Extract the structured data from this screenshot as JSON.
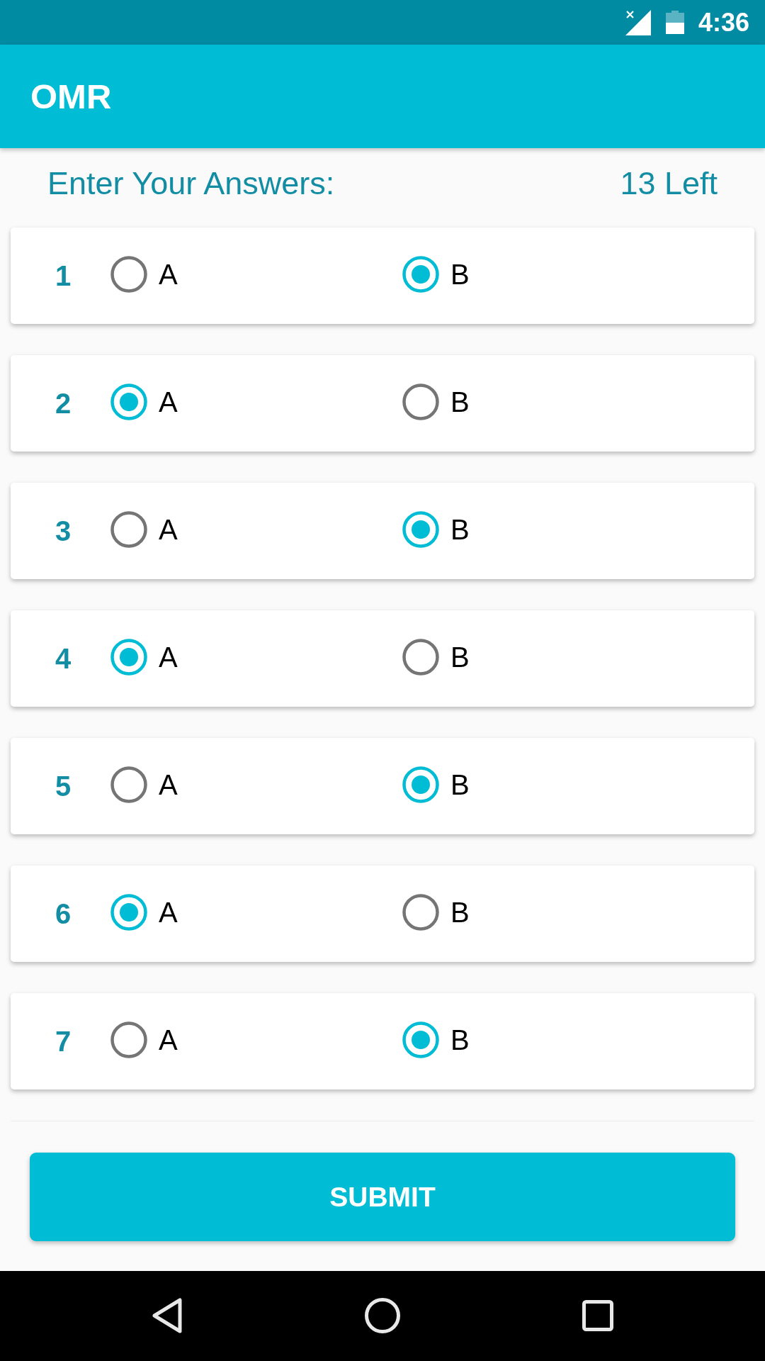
{
  "status_bar": {
    "time": "4:36"
  },
  "app_bar": {
    "title": "OMR"
  },
  "header": {
    "prompt": "Enter Your Answers:",
    "remaining": "13 Left"
  },
  "questions": [
    {
      "number": "1",
      "options": [
        {
          "label": "A",
          "selected": false
        },
        {
          "label": "B",
          "selected": true
        }
      ]
    },
    {
      "number": "2",
      "options": [
        {
          "label": "A",
          "selected": true
        },
        {
          "label": "B",
          "selected": false
        }
      ]
    },
    {
      "number": "3",
      "options": [
        {
          "label": "A",
          "selected": false
        },
        {
          "label": "B",
          "selected": true
        }
      ]
    },
    {
      "number": "4",
      "options": [
        {
          "label": "A",
          "selected": true
        },
        {
          "label": "B",
          "selected": false
        }
      ]
    },
    {
      "number": "5",
      "options": [
        {
          "label": "A",
          "selected": false
        },
        {
          "label": "B",
          "selected": true
        }
      ]
    },
    {
      "number": "6",
      "options": [
        {
          "label": "A",
          "selected": true
        },
        {
          "label": "B",
          "selected": false
        }
      ]
    },
    {
      "number": "7",
      "options": [
        {
          "label": "A",
          "selected": false
        },
        {
          "label": "B",
          "selected": true
        }
      ]
    }
  ],
  "submit_button": {
    "label": "SUBMIT"
  }
}
